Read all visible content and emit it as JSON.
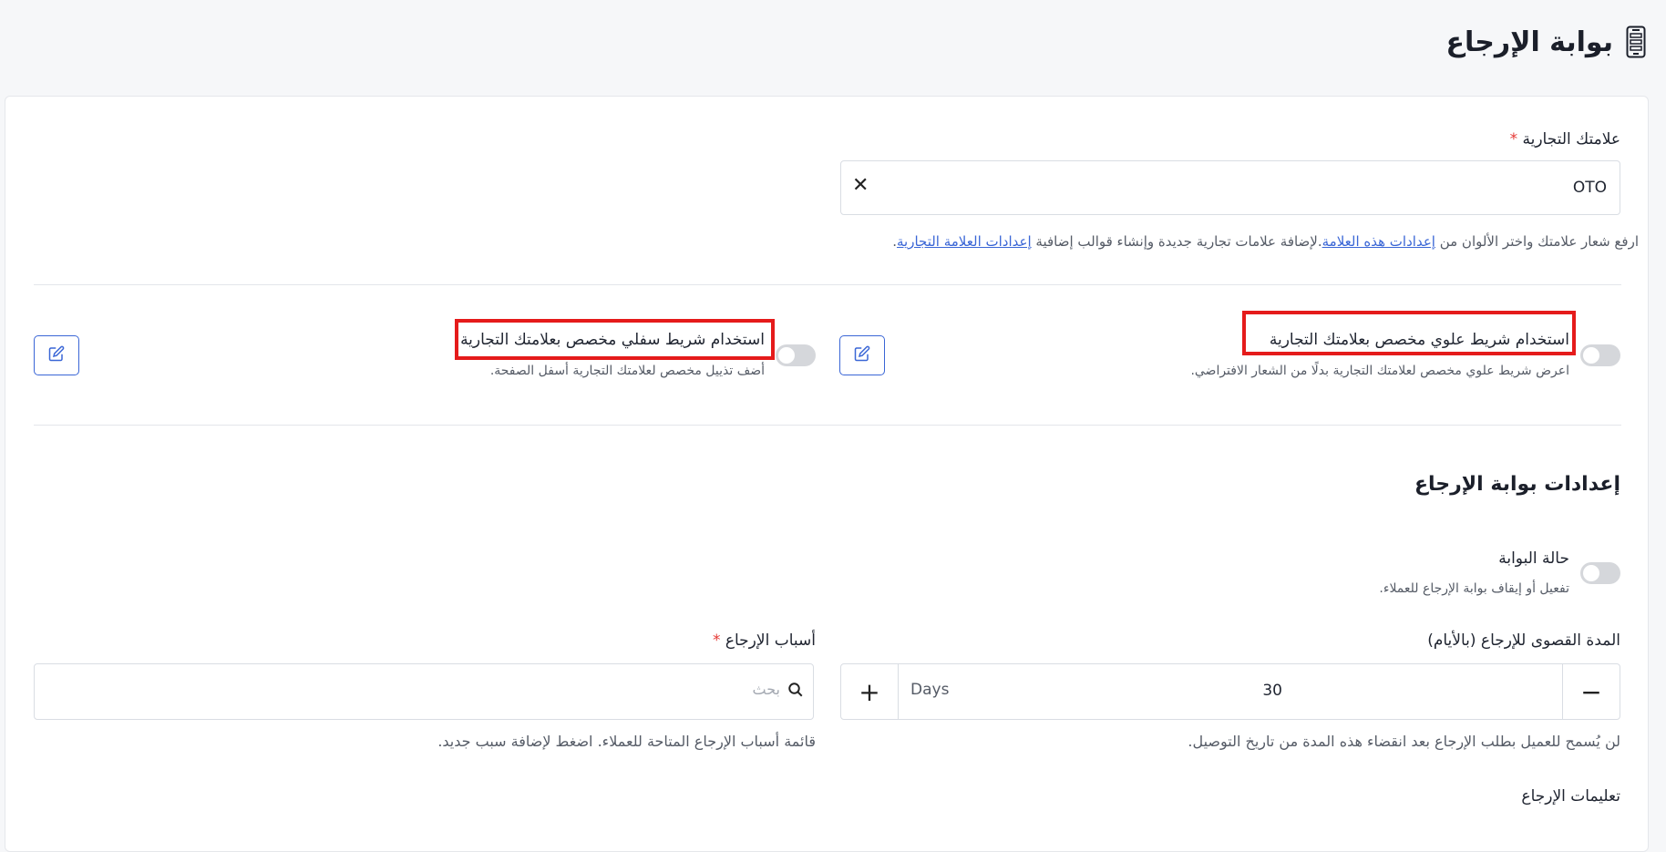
{
  "header": {
    "title": "بوابة الإرجاع",
    "icon": "phone-icon"
  },
  "brand": {
    "label": "علامتك التجارية",
    "required_mark": "*",
    "selected_value": "OTO",
    "help_prefix": "ارفع شعار علامتك واختر الألوان من ",
    "help_link1": "إعدادات هذه العلامة",
    "help_middle": ".لإضافة علامات تجارية جديدة وإنشاء قوالب إضافية ",
    "help_link2": "إعدادات العلامة التجارية",
    "help_suffix": "."
  },
  "top_bar": {
    "label": "استخدام شريط علوي مخصص بعلامتك التجارية",
    "description": "اعرض شريط علوي مخصص لعلامتك التجارية بدلًا من الشعار الافتراضي.",
    "enabled": false
  },
  "bottom_bar": {
    "label": "استخدام شريط سفلي مخصص بعلامتك التجارية",
    "description": "أضف تذييل مخصص لعلامتك التجارية أسفل الصفحة.",
    "enabled": false
  },
  "portal_settings": {
    "title": "إعدادات بوابة الإرجاع",
    "status_label": "حالة البوابة",
    "status_description": "تفعيل أو إيقاف بوابة الإرجاع للعملاء.",
    "status_enabled": false,
    "max_days_label": "المدة القصوى للإرجاع (بالأيام)",
    "max_days_value": "30",
    "max_days_unit": "Days",
    "max_days_help": "لن يُسمح للعميل بطلب الإرجاع بعد انقضاء هذه المدة من تاريخ التوصيل.",
    "reasons_label": "أسباب الإرجاع",
    "reasons_required_mark": "*",
    "reasons_placeholder": "بحث",
    "reasons_help": "قائمة أسباب الإرجاع المتاحة للعملاء. اضغط لإضافة سبب جديد.",
    "instructions_label": "تعليمات الإرجاع"
  },
  "colors": {
    "accent": "#3a66d6",
    "highlight": "#e51b1b",
    "required": "#e53935"
  }
}
